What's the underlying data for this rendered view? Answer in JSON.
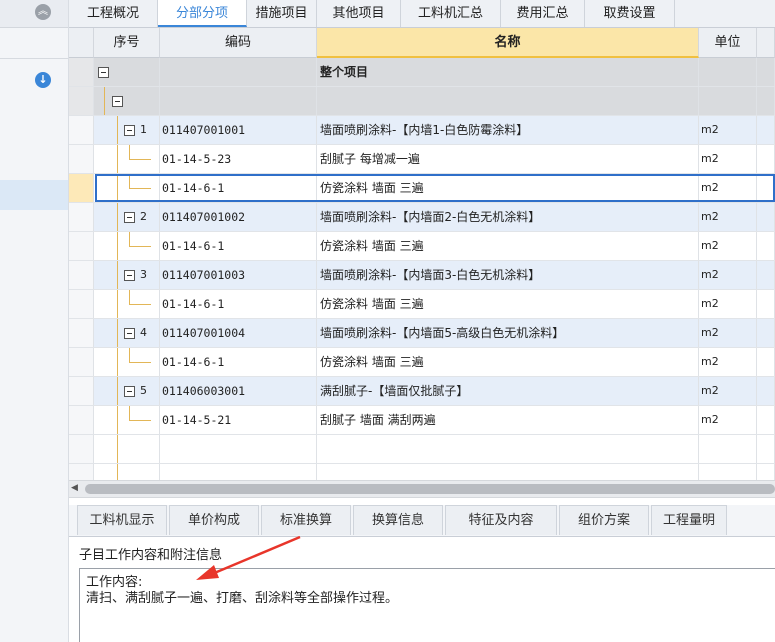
{
  "tabs": [
    "工程概况",
    "分部分项",
    "措施项目",
    "其他项目",
    "工料机汇总",
    "费用汇总",
    "取费设置"
  ],
  "active_tab": "分部分项",
  "columns": {
    "seq": "序号",
    "code": "编码",
    "name": "名称",
    "unit": "单位"
  },
  "rows": [
    {
      "type": "root",
      "seq": "",
      "code": "",
      "name": "整个项目",
      "unit": ""
    },
    {
      "type": "group",
      "seq": "",
      "code": "",
      "name": "",
      "unit": ""
    },
    {
      "type": "item",
      "seq": "1",
      "code": "011407001001",
      "name": "墙面喷刷涂料-【内墙1-白色防霉涂料】",
      "unit": "m2"
    },
    {
      "type": "sub",
      "seq": "",
      "code": "01-14-5-23",
      "name": "刮腻子 每增减一遍",
      "unit": "m2"
    },
    {
      "type": "sub-selected",
      "seq": "",
      "code": "01-14-6-1",
      "name": "仿瓷涂料 墙面 三遍",
      "unit": "m2"
    },
    {
      "type": "item",
      "seq": "2",
      "code": "011407001002",
      "name": "墙面喷刷涂料-【内墙面2-白色无机涂料】",
      "unit": "m2"
    },
    {
      "type": "sub",
      "seq": "",
      "code": "01-14-6-1",
      "name": "仿瓷涂料 墙面 三遍",
      "unit": "m2"
    },
    {
      "type": "item",
      "seq": "3",
      "code": "011407001003",
      "name": "墙面喷刷涂料-【内墙面3-白色无机涂料】",
      "unit": "m2"
    },
    {
      "type": "sub",
      "seq": "",
      "code": "01-14-6-1",
      "name": "仿瓷涂料 墙面 三遍",
      "unit": "m2"
    },
    {
      "type": "item",
      "seq": "4",
      "code": "011407001004",
      "name": "墙面喷刷涂料-【内墙面5-高级白色无机涂料】",
      "unit": "m2"
    },
    {
      "type": "sub",
      "seq": "",
      "code": "01-14-6-1",
      "name": "仿瓷涂料 墙面 三遍",
      "unit": "m2"
    },
    {
      "type": "item",
      "seq": "5",
      "code": "011406003001",
      "name": "满刮腻子-【墙面仅批腻子】",
      "unit": "m2"
    },
    {
      "type": "sub",
      "seq": "",
      "code": "01-14-5-21",
      "name": "刮腻子 墙面 满刮两遍",
      "unit": "m2"
    },
    {
      "type": "empty",
      "seq": "",
      "code": "",
      "name": "",
      "unit": ""
    },
    {
      "type": "empty",
      "seq": "",
      "code": "",
      "name": "",
      "unit": ""
    }
  ],
  "bottom_tabs": [
    "工料机显示",
    "单价构成",
    "标准换算",
    "换算信息",
    "特征及内容",
    "组价方案",
    "工程量明"
  ],
  "info": {
    "title": "子目工作内容和附注信息",
    "line1": "工作内容:",
    "line2": "清扫、满刮腻子一遍、打磨、刮涂料等全部操作过程。"
  },
  "colors": {
    "accent": "#3a86d8",
    "header_highlight": "#fbe6a8",
    "annotation_arrow": "#e8352a"
  }
}
